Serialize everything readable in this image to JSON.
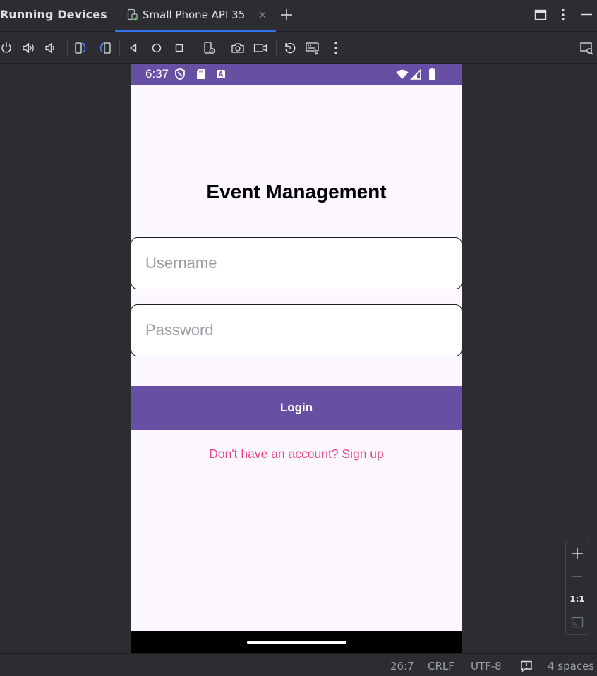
{
  "panel": {
    "title": "Running Devices"
  },
  "tab": {
    "label": "Small Phone API 35"
  },
  "toolbar": {
    "buttons": [
      "power-icon",
      "volume-up-icon",
      "volume-down-icon",
      "rotate-left-icon",
      "rotate-right-icon",
      "back-icon",
      "home-icon",
      "overview-icon",
      "device-settings-icon",
      "screenshot-icon",
      "screen-record-icon",
      "reset-icon",
      "keyboard-icon",
      "more-icon",
      "device-explorer-icon"
    ]
  },
  "device": {
    "status_bar": {
      "time": "6:37"
    },
    "app": {
      "title": "Event Management",
      "username_placeholder": "Username",
      "password_placeholder": "Password",
      "login_label": "Login",
      "signup_text": "Don't have an account? Sign up"
    },
    "colors": {
      "primary": "#6750a4",
      "background": "#fdf7ff",
      "link": "#e94587"
    }
  },
  "zoom": {
    "one_to_one": "1:1"
  },
  "status": {
    "position": "26:7",
    "line_separator": "CRLF",
    "encoding": "UTF-8",
    "indent": "4 spaces"
  }
}
